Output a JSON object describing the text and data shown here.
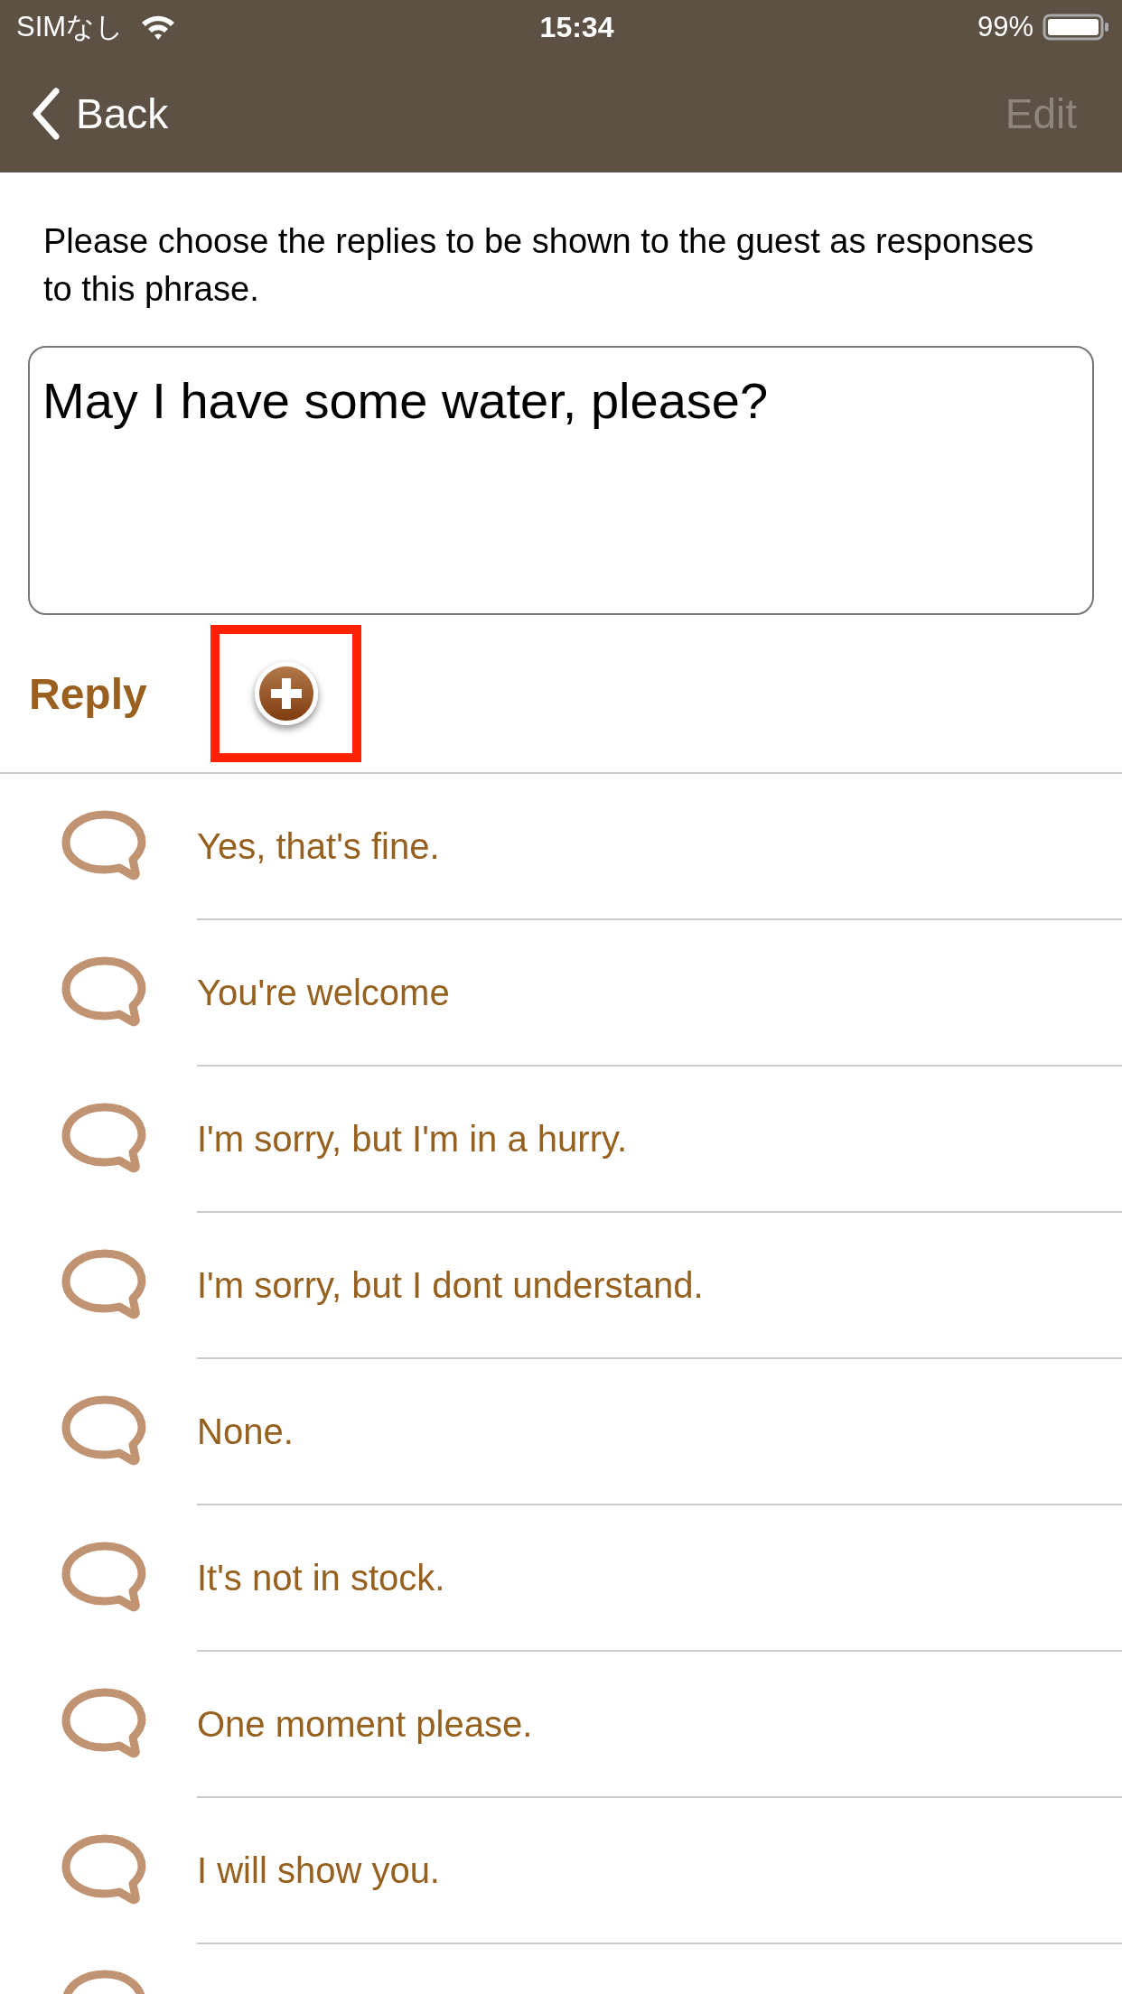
{
  "status_bar": {
    "carrier": "SIMなし",
    "time": "15:34",
    "battery": "99%"
  },
  "nav": {
    "back": "Back",
    "edit": "Edit",
    "edit_disabled": true
  },
  "instruction": "Please choose the replies to be shown to the guest as responses to this phrase.",
  "phrase": {
    "value": "May I have some water, please?"
  },
  "reply_header": {
    "title": "Reply",
    "add_highlighted": true
  },
  "replies": [
    {
      "text": "Yes, that's fine."
    },
    {
      "text": "You're welcome"
    },
    {
      "text": "I'm sorry, but I'm in a hurry."
    },
    {
      "text": "I'm sorry, but I dont understand."
    },
    {
      "text": "None."
    },
    {
      "text": "It's not in stock."
    },
    {
      "text": "One moment please."
    },
    {
      "text": "I will show you."
    }
  ],
  "more_below": true
}
